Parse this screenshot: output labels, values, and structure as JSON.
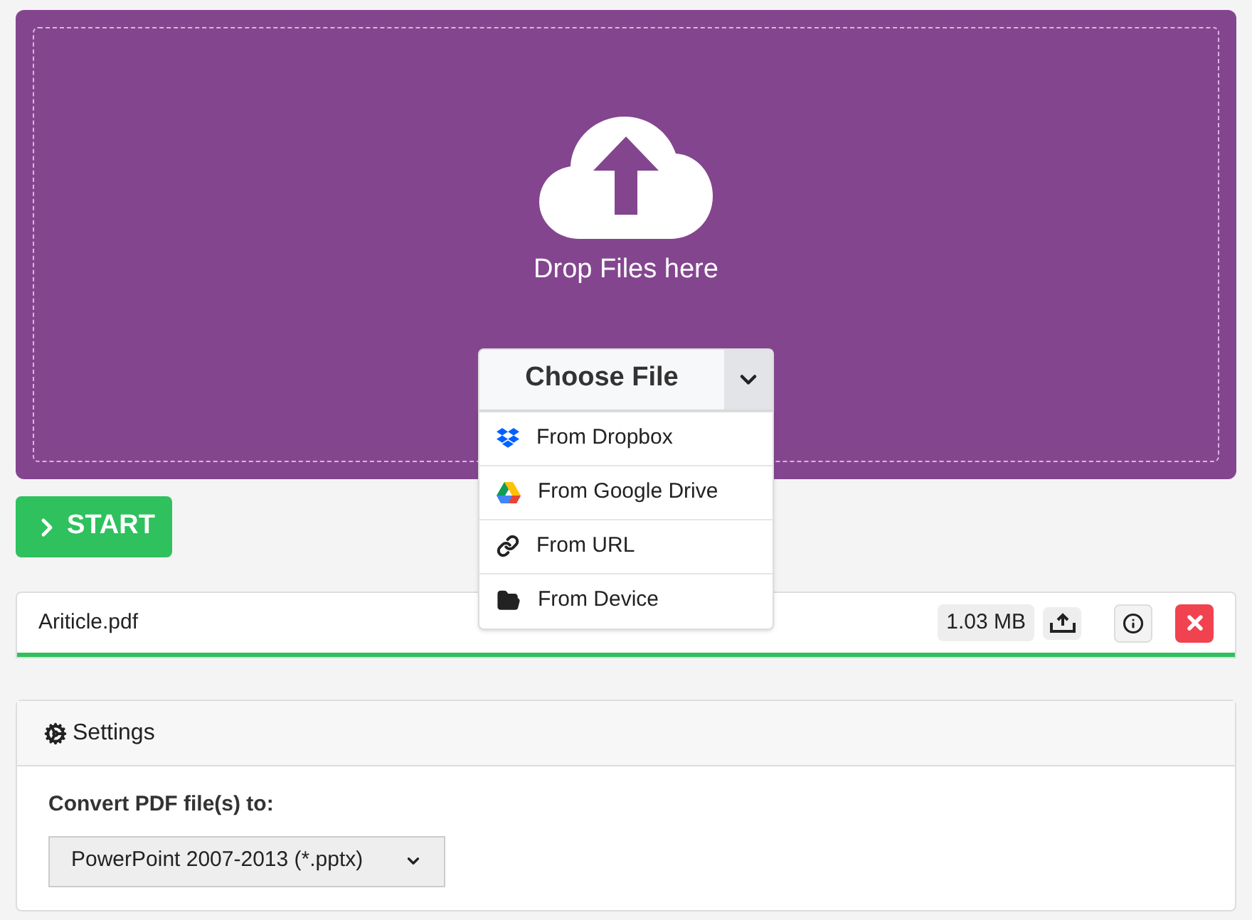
{
  "dropzone": {
    "title": "Drop Files here",
    "choose_button": "Choose File",
    "menu_expanded": true,
    "menu": [
      {
        "kind": "dropbox",
        "label": "From Dropbox"
      },
      {
        "kind": "drive",
        "label": "From Google Drive"
      },
      {
        "kind": "url",
        "label": "From URL"
      },
      {
        "kind": "device",
        "label": "From Device"
      }
    ]
  },
  "start_button": "START",
  "file": {
    "name": "Ariticle.pdf",
    "size": "1.03 MB",
    "level": 1
  },
  "settings": {
    "title": "Settings",
    "label": "Convert PDF file(s) to:",
    "format": "PowerPoint 2007-2013 (*.pptx)"
  }
}
